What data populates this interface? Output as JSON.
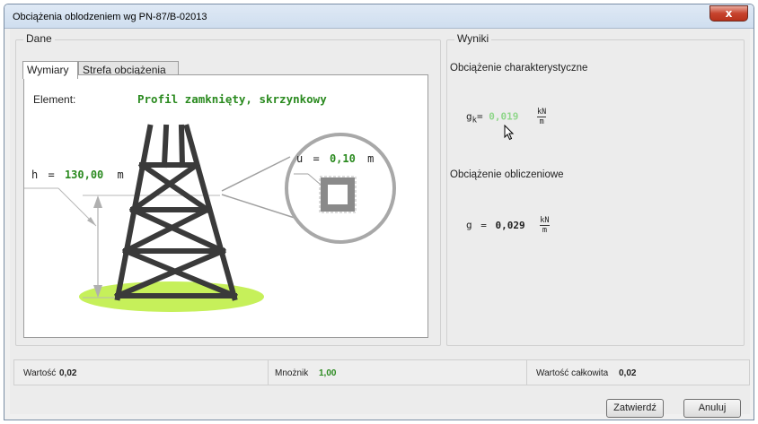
{
  "window": {
    "title": "Obciążenia oblodzeniem wg PN-87/B-02013",
    "close_label": "x"
  },
  "dane": {
    "title": "Dane",
    "tabs": [
      {
        "label": "Wymiary",
        "active": true
      },
      {
        "label": "Strefa obciążenia",
        "active": false
      }
    ],
    "element_label": "Element:",
    "element_value": "Profil zamknięty, skrzynkowy",
    "h_label": "h",
    "h_eq": "=",
    "h_value": "130,00",
    "h_unit": "m",
    "u_label": "u",
    "u_eq": "=",
    "u_value": "0,10",
    "u_unit": "m"
  },
  "wyniki": {
    "title": "Wyniki",
    "char_title": "Obciążenie charakterystyczne",
    "gk_symbol": "g",
    "gk_sub": "k",
    "gk_eq": "=",
    "gk_value": "0,019",
    "gk_unit_num": "kN",
    "gk_unit_den": "m",
    "obl_title": "Obciążenie obliczeniowe",
    "g_symbol": "g",
    "g_eq": "=",
    "g_value": "0,029",
    "g_unit_num": "kN",
    "g_unit_den": "m"
  },
  "status": {
    "wartosc_label": "Wartość",
    "wartosc_value": "0,02",
    "mnoznik_label": "Mnożnik",
    "mnoznik_value": "1,00",
    "calkowita_label": "Wartość całkowita",
    "calkowita_value": "0,02"
  },
  "buttons": {
    "confirm": "Zatwierdź",
    "cancel": "Anuluj"
  },
  "colors": {
    "green": "#2a8a1f",
    "light_green": "#8fd68a",
    "tower": "#3a3a3a",
    "ground": "#c6f05a"
  }
}
